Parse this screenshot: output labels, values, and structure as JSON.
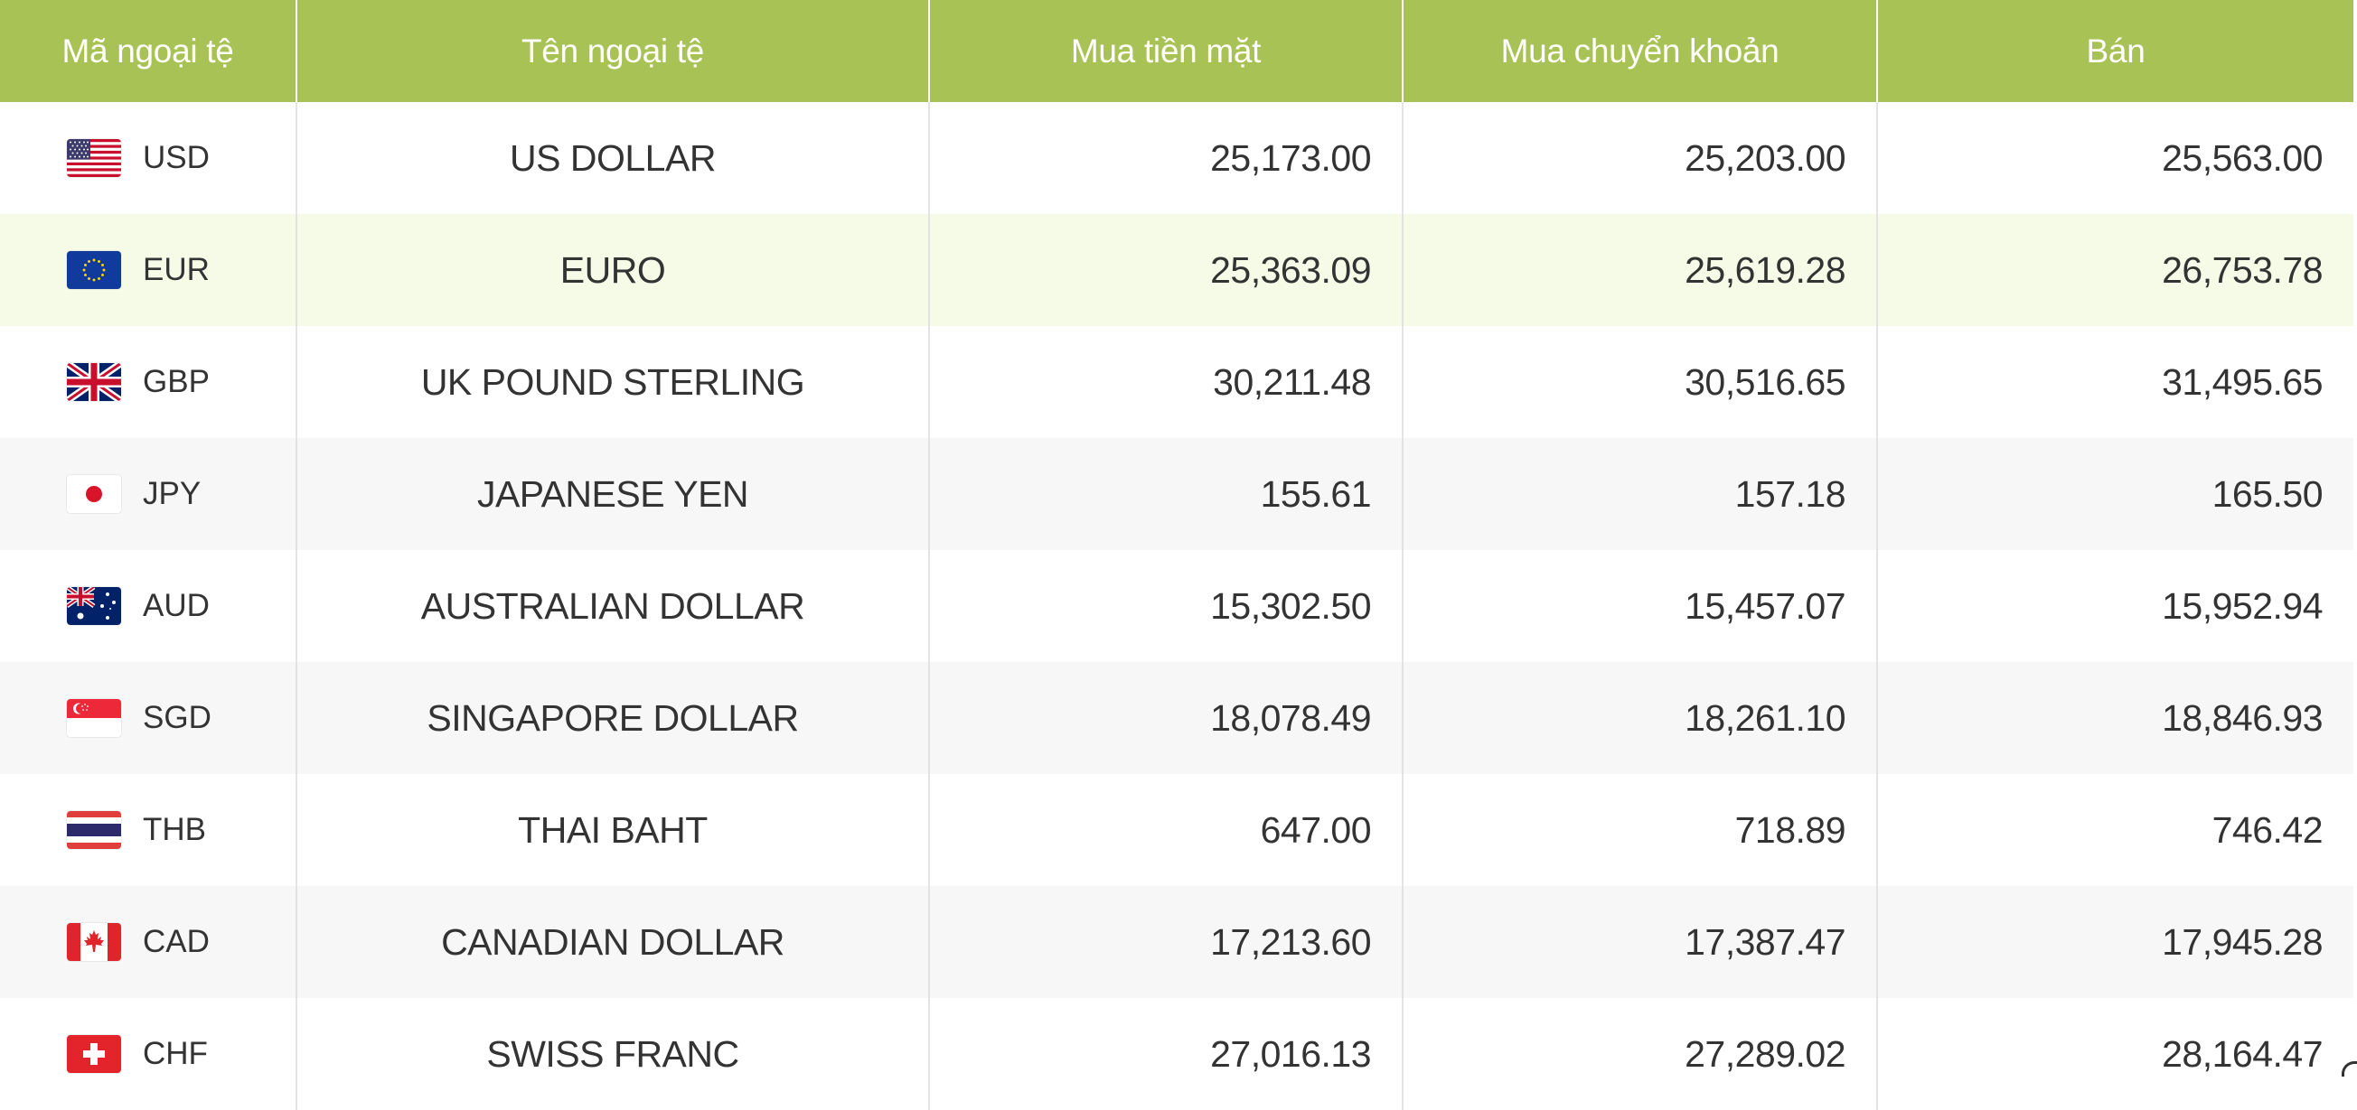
{
  "table": {
    "headers": {
      "code": "Mã ngoại tệ",
      "name": "Tên ngoại tệ",
      "cash_buy": "Mua tiền mặt",
      "transfer_buy": "Mua chuyển khoản",
      "sell": "Bán"
    },
    "rows": [
      {
        "code": "USD",
        "flag": "us-flag-icon",
        "name": "US DOLLAR",
        "cash_buy": "25,173.00",
        "transfer_buy": "25,203.00",
        "sell": "25,563.00"
      },
      {
        "code": "EUR",
        "flag": "eu-flag-icon",
        "name": "EURO",
        "cash_buy": "25,363.09",
        "transfer_buy": "25,619.28",
        "sell": "26,753.78"
      },
      {
        "code": "GBP",
        "flag": "uk-flag-icon",
        "name": "UK POUND STERLING",
        "cash_buy": "30,211.48",
        "transfer_buy": "30,516.65",
        "sell": "31,495.65"
      },
      {
        "code": "JPY",
        "flag": "japan-flag-icon",
        "name": "JAPANESE YEN",
        "cash_buy": "155.61",
        "transfer_buy": "157.18",
        "sell": "165.50"
      },
      {
        "code": "AUD",
        "flag": "australia-flag-icon",
        "name": "AUSTRALIAN DOLLAR",
        "cash_buy": "15,302.50",
        "transfer_buy": "15,457.07",
        "sell": "15,952.94"
      },
      {
        "code": "SGD",
        "flag": "singapore-flag-icon",
        "name": "SINGAPORE DOLLAR",
        "cash_buy": "18,078.49",
        "transfer_buy": "18,261.10",
        "sell": "18,846.93"
      },
      {
        "code": "THB",
        "flag": "thailand-flag-icon",
        "name": "THAI BAHT",
        "cash_buy": "647.00",
        "transfer_buy": "718.89",
        "sell": "746.42"
      },
      {
        "code": "CAD",
        "flag": "canada-flag-icon",
        "name": "CANADIAN DOLLAR",
        "cash_buy": "17,213.60",
        "transfer_buy": "17,387.47",
        "sell": "17,945.28"
      },
      {
        "code": "CHF",
        "flag": "switzerland-flag-icon",
        "name": "SWISS FRANC",
        "cash_buy": "27,016.13",
        "transfer_buy": "27,289.02",
        "sell": "28,164.47"
      }
    ]
  },
  "colors": {
    "header_bg": "#a8c255",
    "header_text": "#ffffff",
    "row_highlight": "#f6fbe8",
    "row_alt": "#f7f7f7"
  }
}
